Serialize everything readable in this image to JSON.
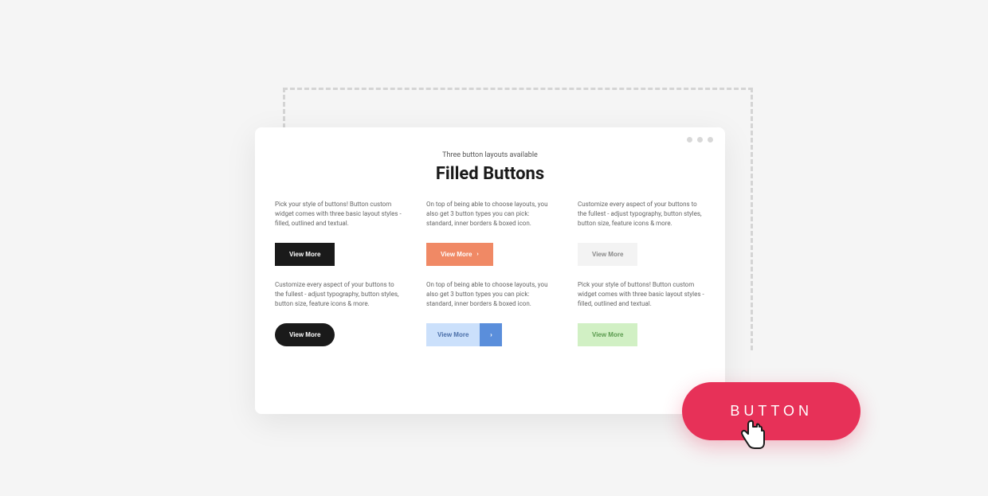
{
  "header": {
    "subtitle": "Three button layouts available",
    "title": "Filled Buttons"
  },
  "cards": [
    {
      "text": "Pick your style of buttons! Button custom widget comes with three basic layout styles - filled, outlined and textual.",
      "button_label": "View More"
    },
    {
      "text": "On top of being able to choose layouts, you also get 3 button types you can pick: standard, inner borders & boxed icon.",
      "button_label": "View More"
    },
    {
      "text": "Customize every aspect of your buttons to the fullest - adjust typography, button styles, button size, feature icons & more.",
      "button_label": "View More"
    },
    {
      "text": "Customize every aspect of your buttons to the fullest - adjust typography, button styles, button size, feature icons & more.",
      "button_label": "View More"
    },
    {
      "text": "On top of being able to choose layouts, you also get 3 button types you can pick: standard, inner borders & boxed icon.",
      "button_label": "View More"
    },
    {
      "text": "Pick your style of buttons! Button custom widget comes with three basic layout styles - filled, outlined and textual.",
      "button_label": "View More"
    }
  ],
  "cta": {
    "label": "BUTTON"
  }
}
